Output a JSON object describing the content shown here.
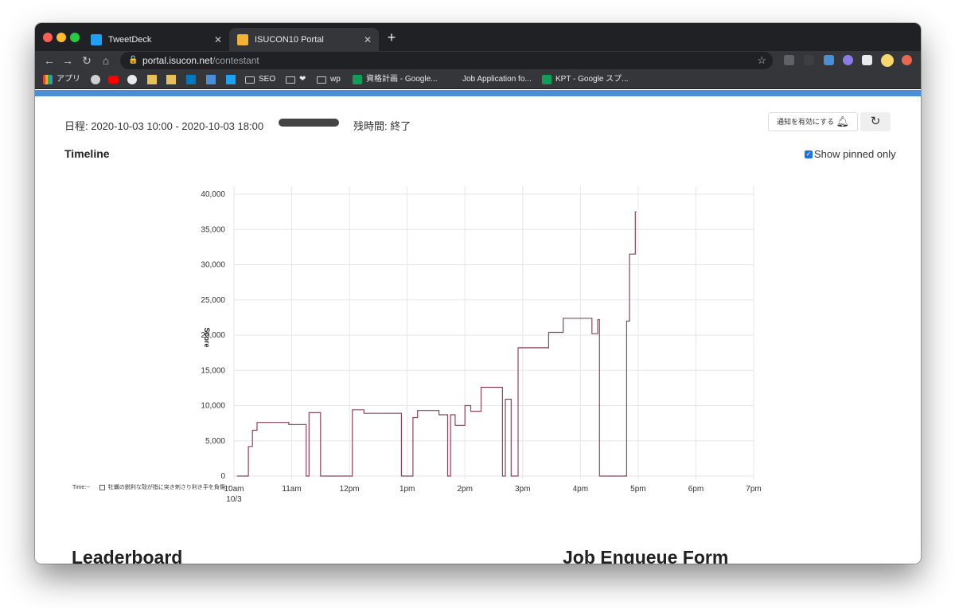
{
  "browser": {
    "tabs": [
      {
        "label": "TweetDeck",
        "favicon_color": "#1da1f2"
      },
      {
        "label": "ISUCON10 Portal",
        "favicon_color": "#f2b233",
        "active": true
      }
    ],
    "url_host": "portal.isucon.net",
    "url_path": "/contestant",
    "bookmarks": [
      "アプリ",
      "SEO",
      "wp",
      "資格計画 - Google...",
      "Job Application fo...",
      "KPT - Google スプ..."
    ]
  },
  "page": {
    "schedule": "日程: 2020-10-03 10:00 - 2020-10-03 18:00",
    "remaining": "残時間: 終了",
    "notify_label": "通知を有効にする",
    "timeline_title": "Timeline",
    "pinned_label": "Show pinned only",
    "pinned_checked": true,
    "legend_time": "Time:--",
    "legend_series": "牡蠣の鋭利な殻が指に突き刺さり利き手を負傷:--",
    "leaderboard_title": "Leaderboard",
    "job_title": "Job Enqueue Form"
  },
  "chart_data": {
    "type": "line",
    "series_name": "牡蠣の鋭利な殻が指に突き刺さり利き手を負傷",
    "color": "#8b4560",
    "ylabel": "Score",
    "ylim": [
      0,
      40000
    ],
    "yticks": [
      "40,000",
      "35,000",
      "30,000",
      "25,000",
      "20,000",
      "15,000",
      "10,000",
      "5,000",
      "0"
    ],
    "xticks": [
      "10am",
      "11am",
      "12pm",
      "1pm",
      "2pm",
      "3pm",
      "4pm",
      "5pm",
      "6pm",
      "7pm"
    ],
    "xtick_sub": "10/3",
    "xlim_hours": [
      10,
      19
    ],
    "points": [
      [
        10.05,
        0
      ],
      [
        10.25,
        0
      ],
      [
        10.25,
        4200
      ],
      [
        10.32,
        4200
      ],
      [
        10.32,
        6500
      ],
      [
        10.4,
        6500
      ],
      [
        10.4,
        7600
      ],
      [
        10.95,
        7600
      ],
      [
        10.95,
        7300
      ],
      [
        11.25,
        7300
      ],
      [
        11.25,
        0
      ],
      [
        11.3,
        0
      ],
      [
        11.3,
        9000
      ],
      [
        11.5,
        9000
      ],
      [
        11.5,
        0
      ],
      [
        12.05,
        0
      ],
      [
        12.05,
        9400
      ],
      [
        12.25,
        9400
      ],
      [
        12.25,
        8900
      ],
      [
        12.9,
        8900
      ],
      [
        12.9,
        0
      ],
      [
        13.1,
        0
      ],
      [
        13.1,
        8300
      ],
      [
        13.18,
        8300
      ],
      [
        13.18,
        9300
      ],
      [
        13.55,
        9300
      ],
      [
        13.55,
        8700
      ],
      [
        13.7,
        8700
      ],
      [
        13.7,
        0
      ],
      [
        13.75,
        0
      ],
      [
        13.75,
        8700
      ],
      [
        13.83,
        8700
      ],
      [
        13.83,
        7200
      ],
      [
        14.0,
        7200
      ],
      [
        14.0,
        10000
      ],
      [
        14.1,
        10000
      ],
      [
        14.1,
        9200
      ],
      [
        14.28,
        9200
      ],
      [
        14.28,
        12600
      ],
      [
        14.65,
        12600
      ],
      [
        14.65,
        0
      ],
      [
        14.7,
        0
      ],
      [
        14.7,
        10900
      ],
      [
        14.8,
        10900
      ],
      [
        14.8,
        0
      ],
      [
        14.92,
        0
      ],
      [
        14.92,
        18200
      ],
      [
        15.45,
        18200
      ],
      [
        15.45,
        20400
      ],
      [
        15.7,
        20400
      ],
      [
        15.7,
        22400
      ],
      [
        16.2,
        22400
      ],
      [
        16.2,
        20200
      ],
      [
        16.3,
        20200
      ],
      [
        16.3,
        22200
      ],
      [
        16.33,
        22200
      ],
      [
        16.33,
        0
      ],
      [
        16.8,
        0
      ],
      [
        16.8,
        22000
      ],
      [
        16.85,
        22000
      ],
      [
        16.85,
        31500
      ],
      [
        16.95,
        31500
      ],
      [
        16.95,
        37500
      ],
      [
        16.97,
        37500
      ]
    ]
  }
}
